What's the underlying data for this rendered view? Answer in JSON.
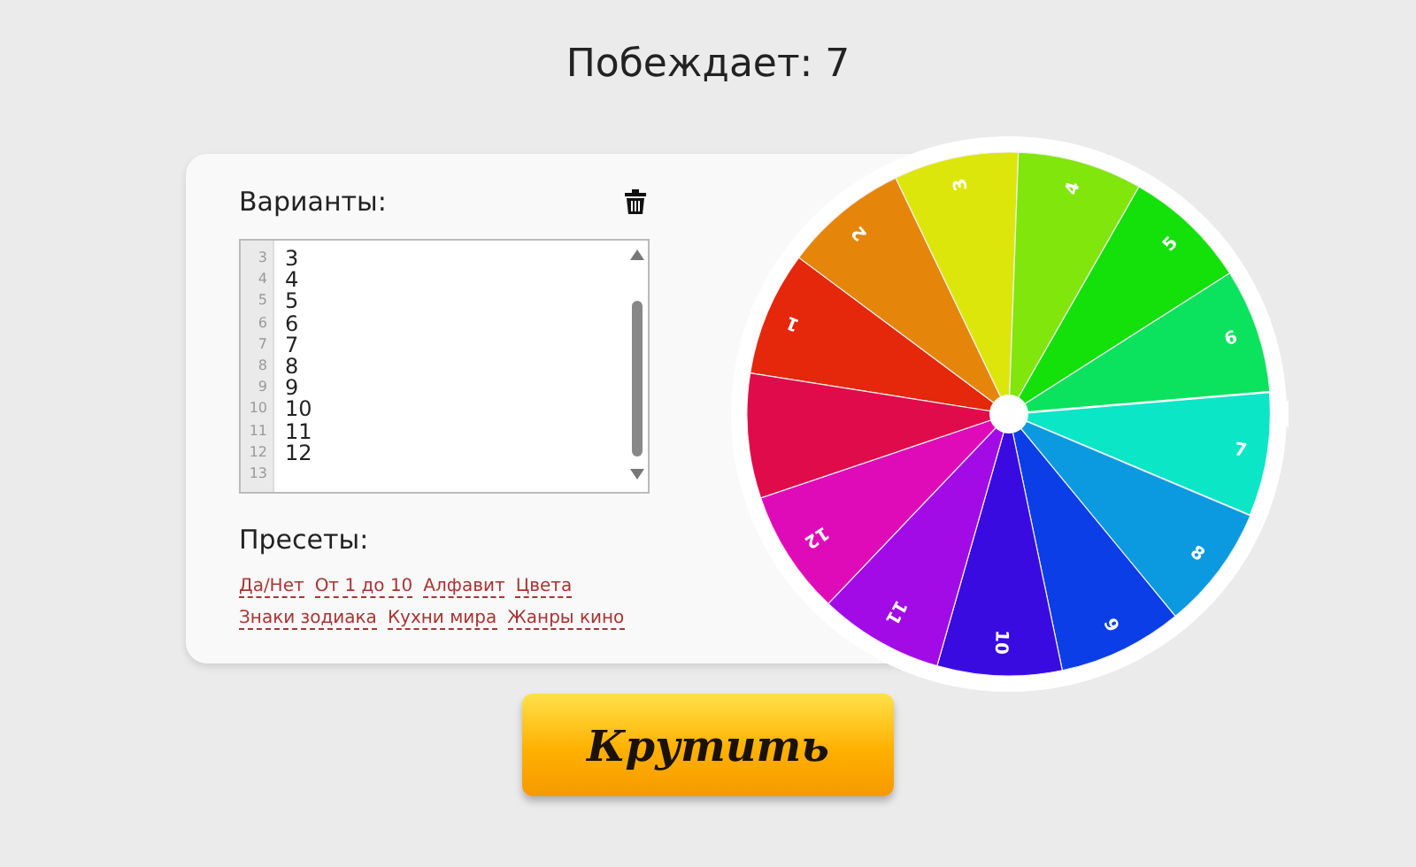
{
  "title": "Побеждает: 7",
  "options": {
    "label": "Варианты:",
    "lines": [
      {
        "number": "3",
        "text": "3"
      },
      {
        "number": "4",
        "text": "4"
      },
      {
        "number": "5",
        "text": "5"
      },
      {
        "number": "6",
        "text": "6"
      },
      {
        "number": "7",
        "text": "7"
      },
      {
        "number": "8",
        "text": "8"
      },
      {
        "number": "9",
        "text": "9"
      },
      {
        "number": "10",
        "text": "10"
      },
      {
        "number": "11",
        "text": "11"
      },
      {
        "number": "12",
        "text": "12"
      },
      {
        "number": "13"
      }
    ]
  },
  "presets": {
    "label": "Пресеты:",
    "links": [
      "Да/Нет",
      "От 1 до 10",
      "Алфавит",
      "Цвета",
      "Знаки зодиака",
      "Кухни мира",
      "Жанры кино"
    ]
  },
  "wheel": {
    "segments": [
      {
        "label": "1",
        "color": "#e5270c",
        "selected": false
      },
      {
        "label": "2",
        "color": "#e5860b",
        "selected": false
      },
      {
        "label": "3",
        "color": "#dde60b",
        "selected": false
      },
      {
        "label": "4",
        "color": "#80e60b",
        "selected": false
      },
      {
        "label": "5",
        "color": "#14e00a",
        "selected": false
      },
      {
        "label": "6",
        "color": "#0be25e",
        "selected": false
      },
      {
        "label": "7",
        "color": "#0be6c6",
        "selected": true
      },
      {
        "label": "8",
        "color": "#0b9ae0",
        "selected": false
      },
      {
        "label": "9",
        "color": "#0b3ee6",
        "selected": false
      },
      {
        "label": "10",
        "color": "#3a0be0",
        "selected": false
      },
      {
        "label": "11",
        "color": "#a20be6",
        "selected": false
      },
      {
        "label": "12",
        "color": "#e00bb8",
        "selected": false
      },
      {
        "color": "#e00b4a",
        "selected": false
      }
    ]
  },
  "spin_button": "Крутить"
}
